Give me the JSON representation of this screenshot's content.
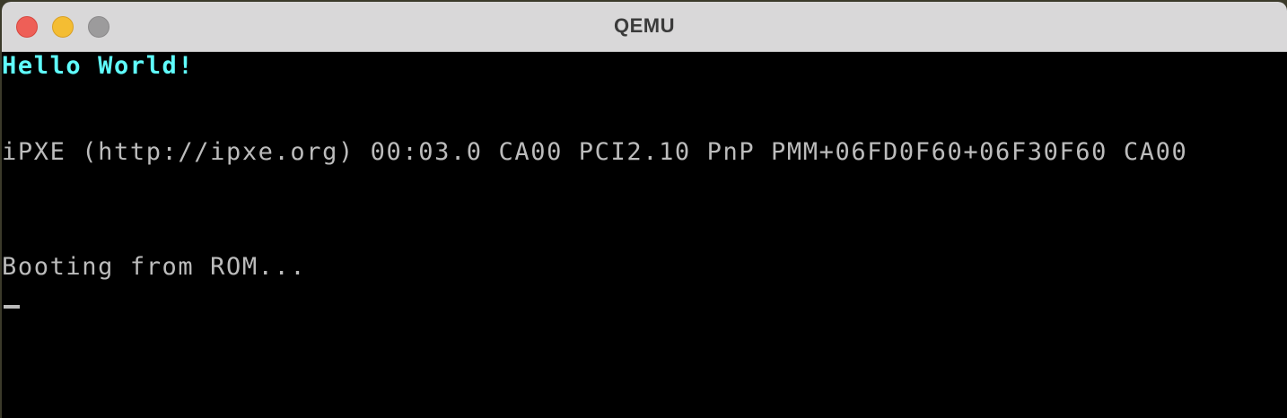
{
  "window": {
    "title": "QEMU"
  },
  "console": {
    "lines": [
      "Hello World!",
      "iPXE (http://ipxe.org) 00:03.0 CA00 PCI2.10 PnP PMM+06FD0F60+06F30F60 CA00",
      "Booting from ROM..."
    ],
    "colors": {
      "highlight": "#5ffcfc",
      "text": "#bcbcbc",
      "background": "#000000"
    }
  }
}
